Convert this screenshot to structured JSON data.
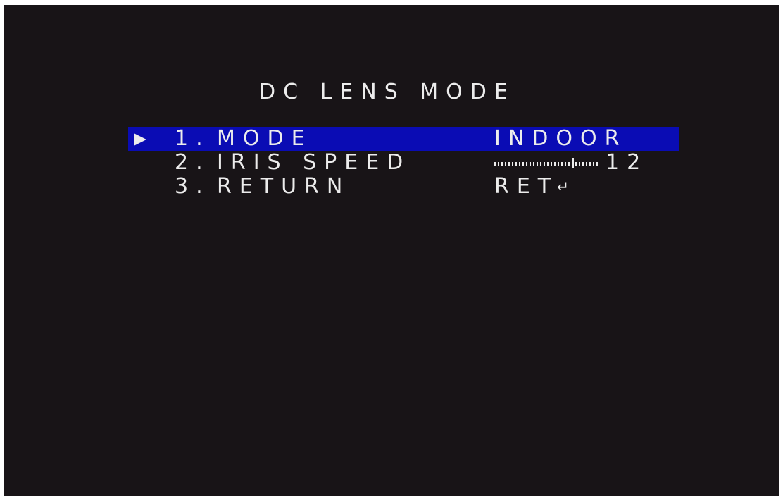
{
  "screen": {
    "title": "DC LENS MODE"
  },
  "menu": {
    "items": [
      {
        "number": "1.",
        "label": "MODE",
        "value": "INDOOR",
        "selected": true
      },
      {
        "number": "2.",
        "label": "IRIS SPEED",
        "value": "12",
        "level": 0.75,
        "selected": false
      },
      {
        "number": "3.",
        "label": "RETURN",
        "value": "RET",
        "selected": false
      }
    ],
    "cursor_icon": "triangle-right-icon",
    "return_icon": "enter-arrow-icon"
  },
  "colors": {
    "background": "#181417",
    "highlight": "#0a0cb4",
    "text": "#ececec"
  }
}
